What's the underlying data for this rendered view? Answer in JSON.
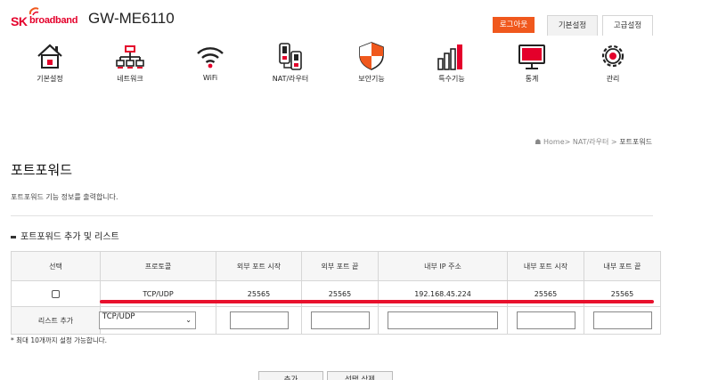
{
  "header": {
    "brand_sk": "SK",
    "brand_name": "broadband",
    "model": "GW-ME6110",
    "logout_label": "로그아웃",
    "tab_basic": "기본설정",
    "tab_advanced": "고급설정"
  },
  "nav": {
    "items": [
      {
        "label": "기본설정",
        "icon": "house-icon"
      },
      {
        "label": "네트워크",
        "icon": "network-icon"
      },
      {
        "label": "WiFi",
        "icon": "wifi-icon"
      },
      {
        "label": "NAT/라우터",
        "icon": "router-icon"
      },
      {
        "label": "보안기능",
        "icon": "shield-icon"
      },
      {
        "label": "특수기능",
        "icon": "bars-icon"
      },
      {
        "label": "통계",
        "icon": "monitor-icon"
      },
      {
        "label": "관리",
        "icon": "gear-icon"
      }
    ]
  },
  "breadcrumb": {
    "home": "Home",
    "sep1": "> NAT/라우터 >",
    "current": "포트포워드"
  },
  "page": {
    "title": "포트포워드",
    "description": "포트포워드 기능 정보를 출력합니다.",
    "section_title": "포트포워드 추가 및 리스트"
  },
  "table": {
    "headers": [
      "선택",
      "프로토콜",
      "외부 포트 시작",
      "외부 포트 끝",
      "내부 IP 주소",
      "내부 포트 시작",
      "내부 포트 끝"
    ],
    "rows": [
      {
        "protocol": "TCP/UDP",
        "ext_start": "25565",
        "ext_end": "25565",
        "internal_ip": "192.168.45.224",
        "int_start": "25565",
        "int_end": "25565"
      }
    ],
    "add_row": {
      "label": "리스트 추가",
      "protocol_selected": "TCP/UDP"
    }
  },
  "note": "* 최대 10개까지 설정 가능합니다.",
  "buttons": {
    "add": "추가",
    "delete_selected": "선택 삭제"
  },
  "colors": {
    "brand_red": "#e4002b",
    "accent_orange": "#f0581d",
    "annotation_red": "#e8112d"
  }
}
